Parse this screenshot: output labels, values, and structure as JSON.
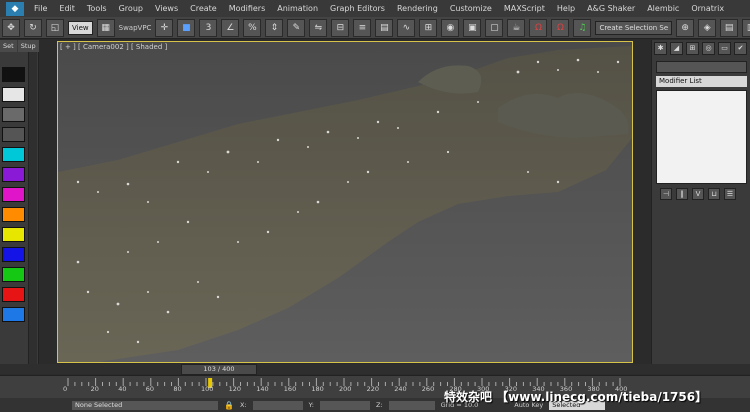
{
  "menubar": {
    "items": [
      "File",
      "Edit",
      "Tools",
      "Group",
      "Views",
      "Create",
      "Modifiers",
      "Animation",
      "Graph Editors",
      "Rendering",
      "Customize",
      "MAXScript",
      "Help",
      "A&G Shaker",
      "Alembic",
      "Ornatrix"
    ]
  },
  "toolbar": {
    "view_select": "View",
    "swap_label": "SwapVPC",
    "selection_set_placeholder": "Create Selection Se"
  },
  "left_panel": {
    "tabs": [
      "Set",
      "Stup"
    ],
    "swatches": [
      "#111111",
      "#e6e6e6",
      "#6a6a6a",
      "#555555",
      "#00c8d8",
      "#8a1ad6",
      "#e014c8",
      "#ff8c00",
      "#e6e600",
      "#1414e6",
      "#14c814",
      "#e61414",
      "#1e78e6"
    ]
  },
  "viewport": {
    "label": "[ + ] [ Camera002 ] [ Shaded ]"
  },
  "right_panel": {
    "modifier_list": "Modifier List"
  },
  "timeline": {
    "frame_display": "103 / 400",
    "ticks": [
      "0",
      "20",
      "40",
      "60",
      "80",
      "100",
      "120",
      "140",
      "160",
      "180",
      "200",
      "220",
      "240",
      "260",
      "280",
      "300",
      "320",
      "340",
      "360",
      "380",
      "400"
    ],
    "current_fraction": 0.2575
  },
  "status": {
    "selection": "None Selected",
    "x_label": "X:",
    "y_label": "Y:",
    "z_label": "Z:",
    "grid": "Grid = 10.0",
    "autokey": "Auto Key",
    "selected": "Selected"
  },
  "watermark": "特效杂吧 【www.linecg.com/tieba/1756】",
  "colors": {
    "accent_viewport_border": "#d8c34a",
    "ui_bg": "#3a3a3a"
  }
}
